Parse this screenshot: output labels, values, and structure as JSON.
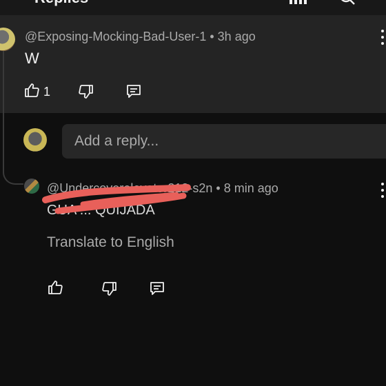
{
  "header": {
    "title": "Replies",
    "icons": [
      "filter-icon",
      "search-icon"
    ]
  },
  "comments": [
    {
      "author_line": "@Exposing-Mocking-Bad-User-1 • 3h ago",
      "text": "W",
      "like_count": "1",
      "icons": [
        "thumbs-up-icon",
        "thumbs-down-icon",
        "reply-icon",
        "more-icon"
      ]
    },
    {
      "author_line": "@Undercoverelevator212-s2n • 8 min ago",
      "text": "GUA ... QUIJADA",
      "text_obscured": true,
      "translate_label": "Translate to English",
      "like_count": "",
      "icons": [
        "thumbs-up-icon",
        "thumbs-down-icon",
        "reply-icon",
        "more-icon"
      ]
    }
  ],
  "reply_box": {
    "placeholder": "Add a reply..."
  },
  "colors": {
    "background": "#0f0f0f",
    "highlight_panel": "#242424",
    "reply_field": "#272727",
    "muted_text": "#aaaaaa",
    "primary_text": "#f1f1f1",
    "scribble": "#e8605a"
  }
}
